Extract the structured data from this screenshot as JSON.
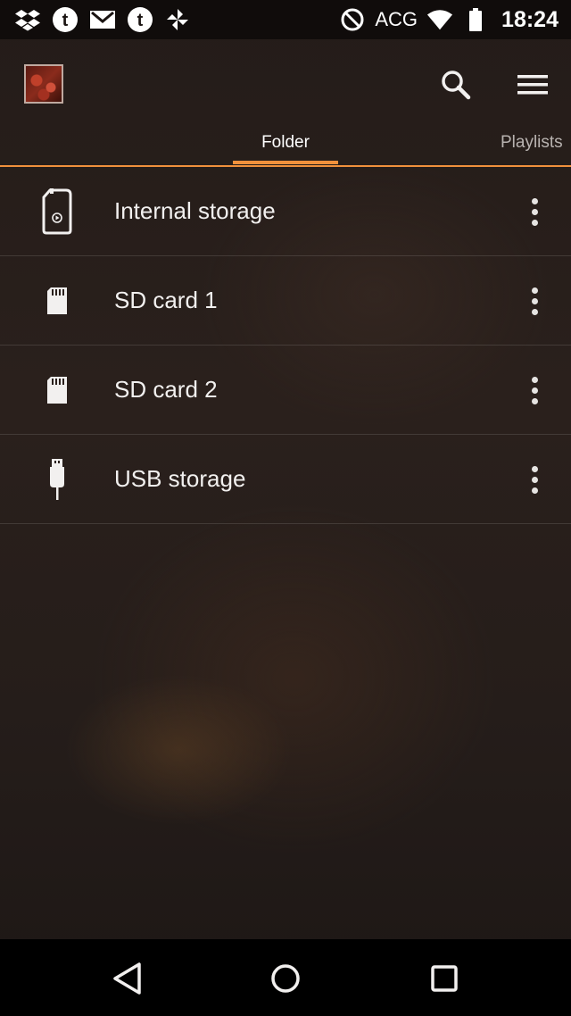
{
  "status_bar": {
    "left_icons": [
      "dropbox-icon",
      "tumblr-icon",
      "gmail-icon",
      "tumblr-icon",
      "pinwheel-icon"
    ],
    "carrier": "ACG",
    "time": "18:24"
  },
  "tabs": [
    {
      "label": "Folder",
      "selected": true
    },
    {
      "label": "Playlists",
      "selected": false
    }
  ],
  "storage": [
    {
      "label": "Internal storage",
      "icon": "internal-storage-icon"
    },
    {
      "label": "SD card 1",
      "icon": "sd-card-icon"
    },
    {
      "label": "SD card 2",
      "icon": "sd-card-icon"
    },
    {
      "label": "USB storage",
      "icon": "usb-icon"
    }
  ],
  "colors": {
    "accent": "#f0913c",
    "background": "#241c19"
  },
  "nav": [
    "back-icon",
    "home-icon",
    "recents-icon"
  ]
}
